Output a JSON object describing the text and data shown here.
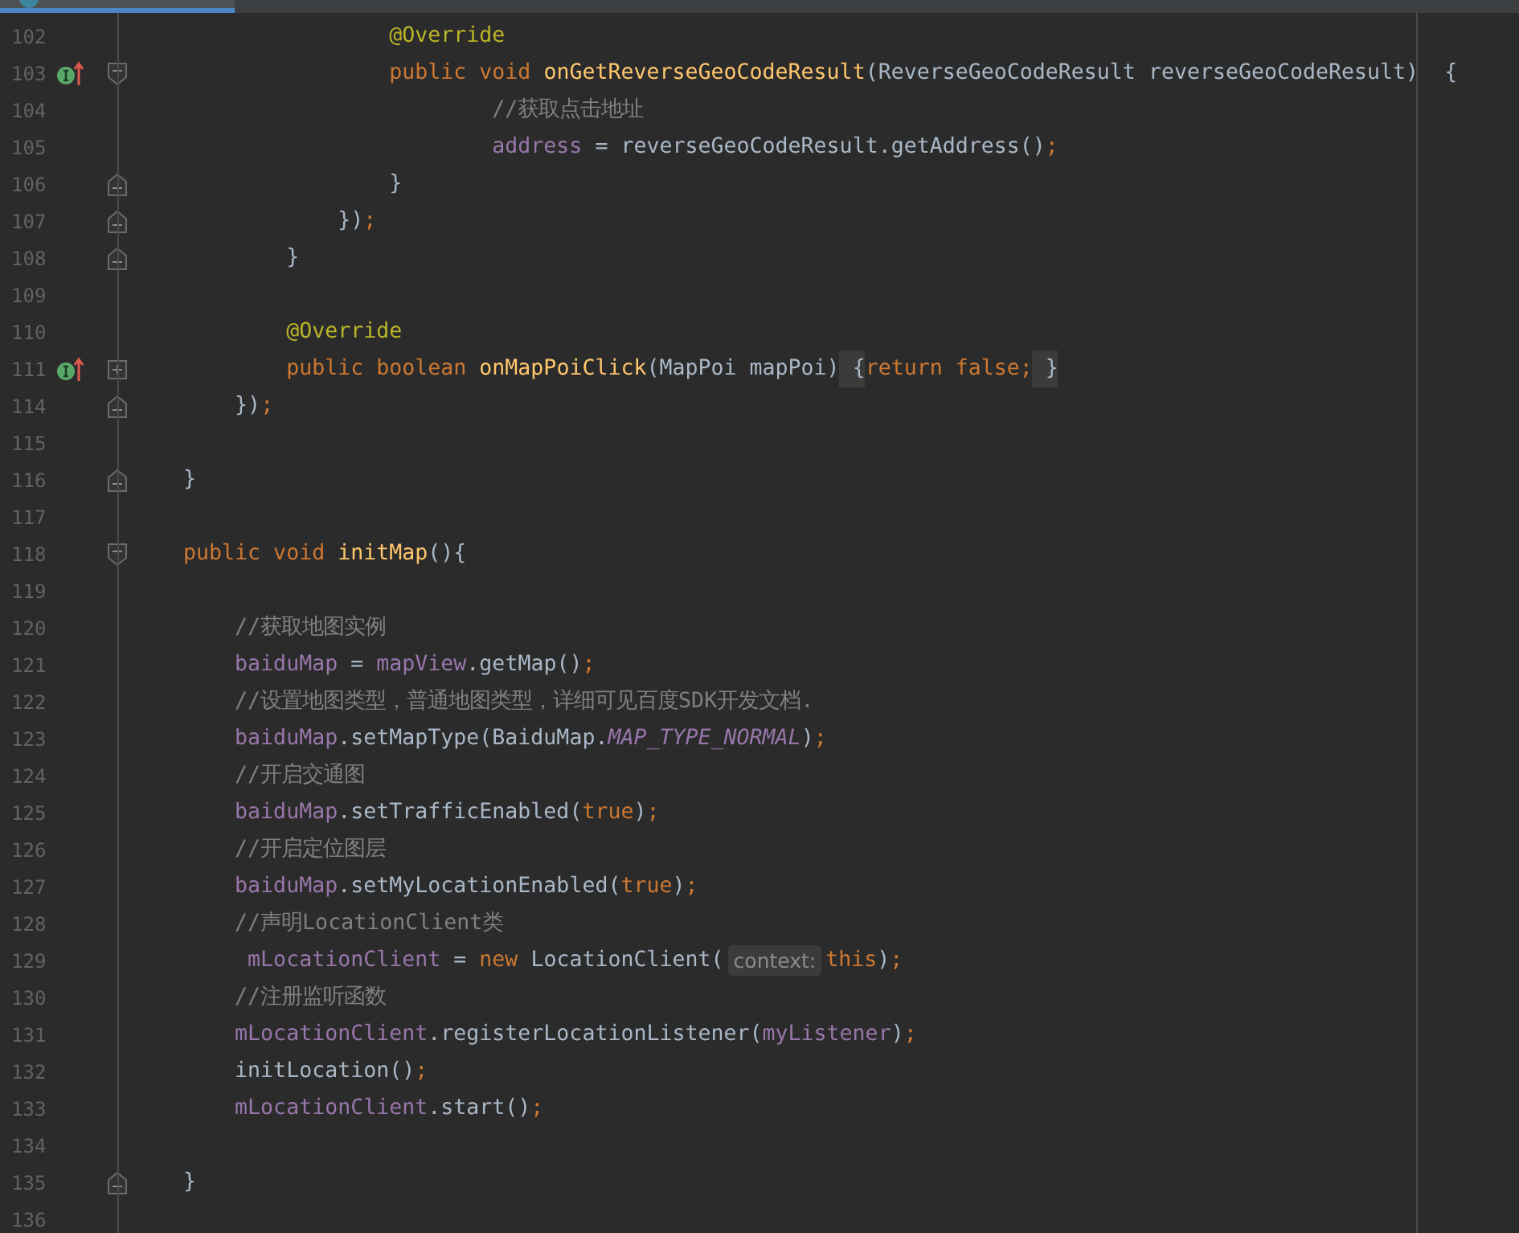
{
  "editor": {
    "lines": [
      {
        "number": "102",
        "override": false,
        "tokens": [
          {
            "kind": "annotation",
            "text": "                    @Override"
          }
        ]
      },
      {
        "number": "103",
        "override": true,
        "fold": {
          "kind": "open"
        },
        "tokens": [
          {
            "kind": "keyword",
            "text": "                    public void "
          },
          {
            "kind": "method",
            "text": "onGetReverseGeoCodeResult"
          },
          {
            "kind": "plain",
            "text": "(ReverseGeoCodeResult reverseGeoCodeResult)  {"
          }
        ]
      },
      {
        "number": "104",
        "override": false,
        "tokens": [
          {
            "kind": "comment",
            "text": "                            //获取点击地址"
          }
        ]
      },
      {
        "number": "105",
        "override": false,
        "tokens": [
          {
            "kind": "field",
            "text": "                            address"
          },
          {
            "kind": "plain",
            "text": " = reverseGeoCodeResult.getAddress()"
          },
          {
            "kind": "keyword",
            "text": ";"
          }
        ]
      },
      {
        "number": "106",
        "override": false,
        "fold": {
          "kind": "close"
        },
        "tokens": [
          {
            "kind": "plain",
            "text": "                    }"
          }
        ]
      },
      {
        "number": "107",
        "override": false,
        "fold": {
          "kind": "close"
        },
        "tokens": [
          {
            "kind": "plain",
            "text": "                })"
          },
          {
            "kind": "keyword",
            "text": ";"
          }
        ]
      },
      {
        "number": "108",
        "override": false,
        "fold": {
          "kind": "close"
        },
        "tokens": [
          {
            "kind": "plain",
            "text": "            }"
          }
        ]
      },
      {
        "number": "109",
        "override": false
      },
      {
        "number": "110",
        "override": false,
        "tokens": [
          {
            "kind": "annotation",
            "text": "            @Override"
          }
        ]
      },
      {
        "number": "111",
        "override": true,
        "fold": {
          "kind": "folded"
        },
        "tokens": [
          {
            "kind": "keyword",
            "text": "            public boolean "
          },
          {
            "kind": "method",
            "text": "onMapPoiClick"
          },
          {
            "kind": "plain",
            "text": "(MapPoi mapPoi)"
          },
          {
            "kind": "folded",
            "text": " {"
          },
          {
            "kind": "keyword",
            "text": "return false;"
          },
          {
            "kind": "folded",
            "text": " }"
          }
        ]
      },
      {
        "number": "114",
        "override": false,
        "fold": {
          "kind": "close"
        },
        "tokens": [
          {
            "kind": "plain",
            "text": "        })"
          },
          {
            "kind": "keyword",
            "text": ";"
          }
        ]
      },
      {
        "number": "115",
        "override": false
      },
      {
        "number": "116",
        "override": false,
        "fold": {
          "kind": "close"
        },
        "tokens": [
          {
            "kind": "plain",
            "text": "    }"
          }
        ]
      },
      {
        "number": "117",
        "override": false
      },
      {
        "number": "118",
        "override": false,
        "fold": {
          "kind": "open"
        },
        "tokens": [
          {
            "kind": "keyword",
            "text": "    public void "
          },
          {
            "kind": "method",
            "text": "initMap"
          },
          {
            "kind": "plain",
            "text": "(){"
          }
        ]
      },
      {
        "number": "119",
        "override": false
      },
      {
        "number": "120",
        "override": false,
        "tokens": [
          {
            "kind": "comment",
            "text": "        //获取地图实例"
          }
        ]
      },
      {
        "number": "121",
        "override": false,
        "tokens": [
          {
            "kind": "field",
            "text": "        baiduMap"
          },
          {
            "kind": "plain",
            "text": " = "
          },
          {
            "kind": "field",
            "text": "mapView"
          },
          {
            "kind": "plain",
            "text": ".getMap()"
          },
          {
            "kind": "keyword",
            "text": ";"
          }
        ]
      },
      {
        "number": "122",
        "override": false,
        "tokens": [
          {
            "kind": "comment",
            "text": "        //设置地图类型，普通地图类型，详细可见百度SDK开发文档."
          }
        ]
      },
      {
        "number": "123",
        "override": false,
        "tokens": [
          {
            "kind": "field",
            "text": "        baiduMap"
          },
          {
            "kind": "plain",
            "text": ".setMapType(BaiduMap."
          },
          {
            "kind": "constant",
            "text": "MAP_TYPE_NORMAL"
          },
          {
            "kind": "plain",
            "text": ")"
          },
          {
            "kind": "keyword",
            "text": ";"
          }
        ]
      },
      {
        "number": "124",
        "override": false,
        "tokens": [
          {
            "kind": "comment",
            "text": "        //开启交通图"
          }
        ]
      },
      {
        "number": "125",
        "override": false,
        "tokens": [
          {
            "kind": "field",
            "text": "        baiduMap"
          },
          {
            "kind": "plain",
            "text": ".setTrafficEnabled("
          },
          {
            "kind": "keyword",
            "text": "true"
          },
          {
            "kind": "plain",
            "text": ")"
          },
          {
            "kind": "keyword",
            "text": ";"
          }
        ]
      },
      {
        "number": "126",
        "override": false,
        "tokens": [
          {
            "kind": "comment",
            "text": "        //开启定位图层"
          }
        ]
      },
      {
        "number": "127",
        "override": false,
        "tokens": [
          {
            "kind": "field",
            "text": "        baiduMap"
          },
          {
            "kind": "plain",
            "text": ".setMyLocationEnabled("
          },
          {
            "kind": "keyword",
            "text": "true"
          },
          {
            "kind": "plain",
            "text": ")"
          },
          {
            "kind": "keyword",
            "text": ";"
          }
        ]
      },
      {
        "number": "128",
        "override": false,
        "tokens": [
          {
            "kind": "comment",
            "text": "        //声明LocationClient类"
          }
        ]
      },
      {
        "number": "129",
        "override": false,
        "tokens": [
          {
            "kind": "field",
            "text": "         mLocationClient"
          },
          {
            "kind": "plain",
            "text": " = "
          },
          {
            "kind": "keyword",
            "text": "new"
          },
          {
            "kind": "plain",
            "text": " LocationClient("
          },
          {
            "kind": "hint",
            "text": "context:"
          },
          {
            "kind": "keyword",
            "text": "this"
          },
          {
            "kind": "plain",
            "text": ")"
          },
          {
            "kind": "keyword",
            "text": ";"
          }
        ]
      },
      {
        "number": "130",
        "override": false,
        "tokens": [
          {
            "kind": "comment",
            "text": "        //注册监听函数"
          }
        ]
      },
      {
        "number": "131",
        "override": false,
        "tokens": [
          {
            "kind": "field",
            "text": "        mLocationClient"
          },
          {
            "kind": "plain",
            "text": ".registerLocationListener("
          },
          {
            "kind": "field",
            "text": "myListener"
          },
          {
            "kind": "plain",
            "text": ")"
          },
          {
            "kind": "keyword",
            "text": ";"
          }
        ]
      },
      {
        "number": "132",
        "override": false,
        "tokens": [
          {
            "kind": "plain",
            "text": "        initLocation()"
          },
          {
            "kind": "keyword",
            "text": ";"
          }
        ]
      },
      {
        "number": "133",
        "override": false,
        "tokens": [
          {
            "kind": "field",
            "text": "        mLocationClient"
          },
          {
            "kind": "plain",
            "text": ".start()"
          },
          {
            "kind": "keyword",
            "text": ";"
          }
        ]
      },
      {
        "number": "134",
        "override": false
      },
      {
        "number": "135",
        "override": false,
        "fold": {
          "kind": "close"
        },
        "tokens": [
          {
            "kind": "plain",
            "text": "    }"
          }
        ]
      },
      {
        "number": "136",
        "override": false
      }
    ]
  }
}
